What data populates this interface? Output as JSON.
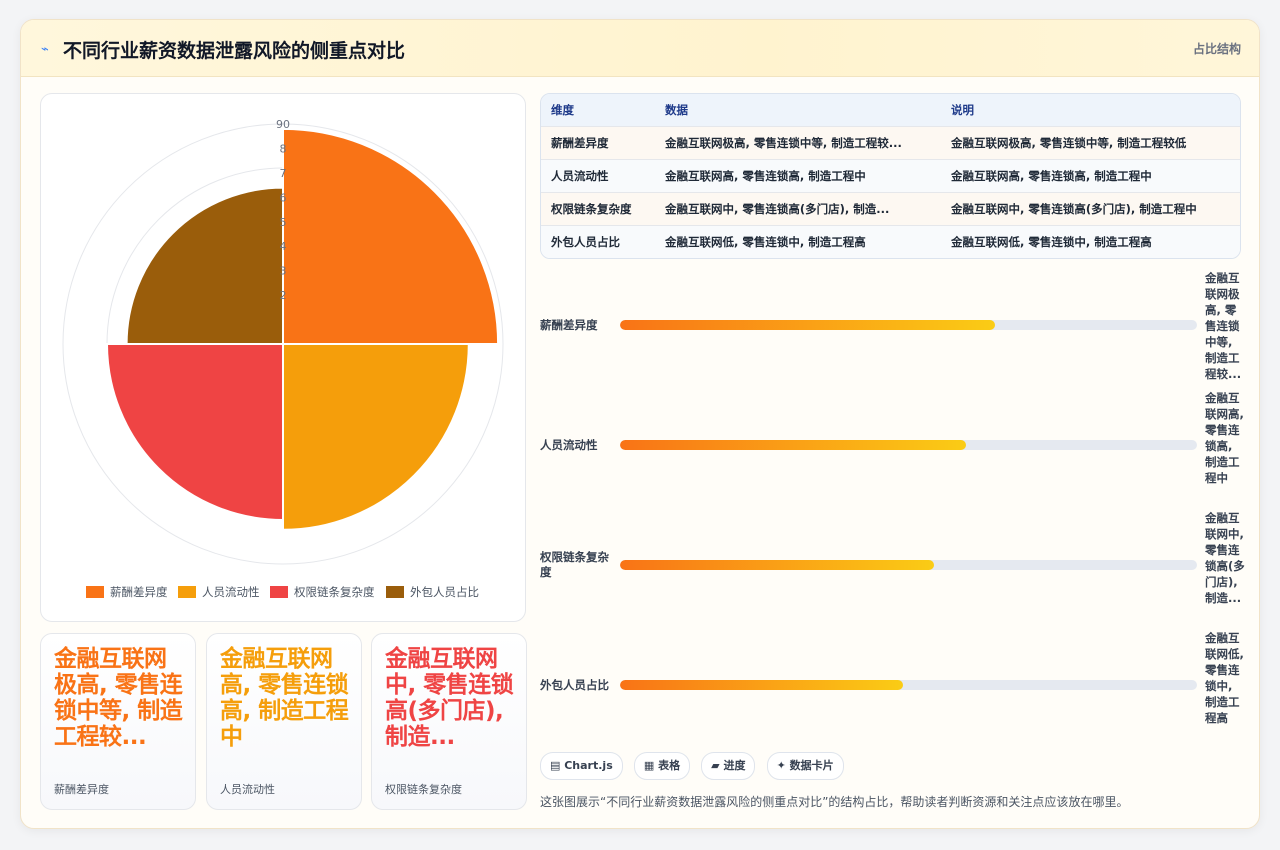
{
  "header": {
    "icon": "chart-icon",
    "title": "不同行业薪资数据泄露风险的侧重点对比",
    "subtitle": "占比结构"
  },
  "chart_data": {
    "type": "polarArea",
    "categories": [
      "薪酬差异度",
      "人员流动性",
      "权限链条复杂度",
      "外包人员占比"
    ],
    "values": [
      88,
      76,
      72,
      64
    ],
    "colors": [
      "#f97316",
      "#f59e0b",
      "#ef4444",
      "#9a5d0b"
    ],
    "rlim": [
      0,
      90
    ],
    "radial_ticks": [
      "2",
      "3",
      "4",
      "5",
      "6",
      "7",
      "8",
      "90"
    ],
    "legend_position": "bottom",
    "grid": true
  },
  "kpis": [
    {
      "value": "金融互联网极高, 零售连锁中等, 制造工程较...",
      "label": "薪酬差异度",
      "color": "#f97316"
    },
    {
      "value": "金融互联网高, 零售连锁高, 制造工程中",
      "label": "人员流动性",
      "color": "#f59e0b"
    },
    {
      "value": "金融互联网中, 零售连锁高(多门店), 制造...",
      "label": "权限链条复杂度",
      "color": "#ef4444"
    }
  ],
  "table": {
    "headers": [
      "维度",
      "数据",
      "说明"
    ],
    "rows": [
      [
        "薪酬差异度",
        "金融互联网极高, 零售连锁中等, 制造工程较...",
        "金融互联网极高, 零售连锁中等, 制造工程较低"
      ],
      [
        "人员流动性",
        "金融互联网高, 零售连锁高, 制造工程中",
        "金融互联网高, 零售连锁高, 制造工程中"
      ],
      [
        "权限链条复杂度",
        "金融互联网中, 零售连锁高(多门店), 制造...",
        "金融互联网中, 零售连锁高(多门店), 制造工程中"
      ],
      [
        "外包人员占比",
        "金融互联网低, 零售连锁中, 制造工程高",
        "金融互联网低, 零售连锁中, 制造工程高"
      ]
    ]
  },
  "progress": [
    {
      "label": "薪酬差异度",
      "fraction": 0.65,
      "note": "金融互联网极高, 零售连锁中等, 制造工程较..."
    },
    {
      "label": "人员流动性",
      "fraction": 0.6,
      "note": "金融互联网高, 零售连锁高, 制造工程中"
    },
    {
      "label": "权限链条复杂度",
      "fraction": 0.545,
      "note": "金融互联网中, 零售连锁高(多门店), 制造..."
    },
    {
      "label": "外包人员占比",
      "fraction": 0.49,
      "note": "金融互联网低, 零售连锁中, 制造工程高"
    }
  ],
  "tags": [
    {
      "icon": "chart-icon",
      "text": "Chart.js"
    },
    {
      "icon": "table-icon",
      "text": "表格"
    },
    {
      "icon": "progress-icon",
      "text": "进度"
    },
    {
      "icon": "sparkle-icon",
      "text": "数据卡片"
    }
  ],
  "footnote": "这张图展示“不同行业薪资数据泄露风险的侧重点对比”的结构占比，帮助读者判断资源和关注点应该放在哪里。"
}
